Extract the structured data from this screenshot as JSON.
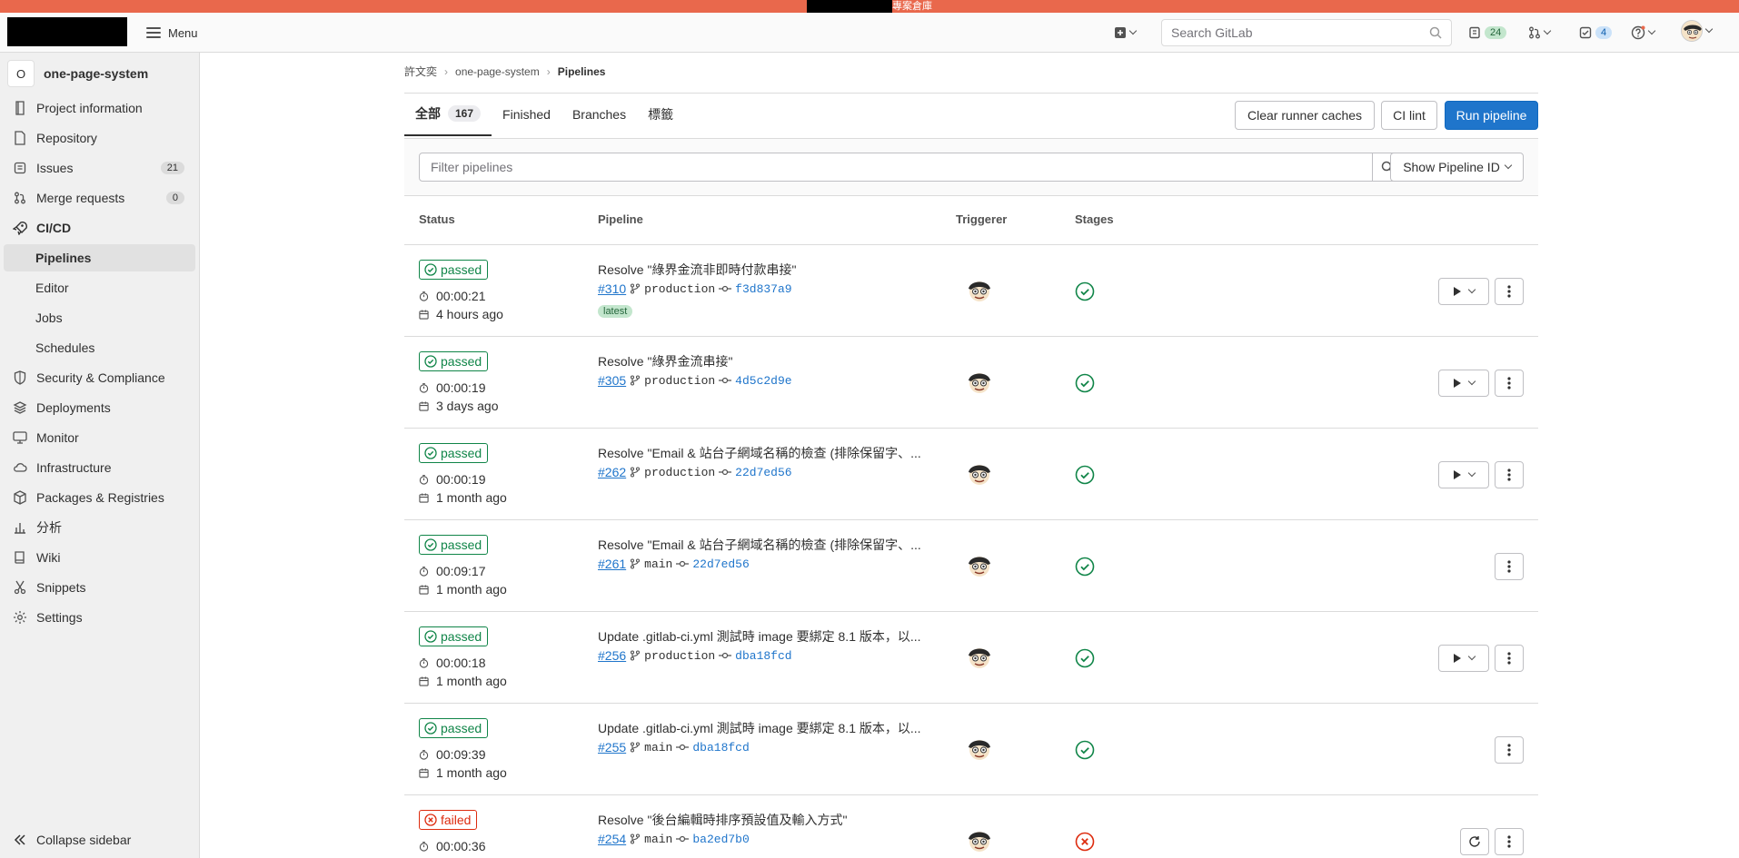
{
  "banner": {
    "text": "專案倉庫",
    "color": "#e9684c"
  },
  "topbar": {
    "menu_label": "Menu",
    "search_placeholder": "Search GitLab",
    "issues_count": "24",
    "todos_count": "4"
  },
  "sidebar": {
    "project_initial": "O",
    "project_name": "one-page-system",
    "items": [
      {
        "label": "Project information",
        "icon": "info-icon"
      },
      {
        "label": "Repository",
        "icon": "doc-icon"
      },
      {
        "label": "Issues",
        "icon": "issues-icon",
        "count": "21"
      },
      {
        "label": "Merge requests",
        "icon": "merge-icon",
        "count": "0"
      },
      {
        "label": "CI/CD",
        "icon": "rocket-icon"
      },
      {
        "label": "Pipelines"
      },
      {
        "label": "Editor"
      },
      {
        "label": "Jobs"
      },
      {
        "label": "Schedules"
      },
      {
        "label": "Security & Compliance",
        "icon": "shield-icon"
      },
      {
        "label": "Deployments",
        "icon": "deploy-icon"
      },
      {
        "label": "Monitor",
        "icon": "monitor-icon"
      },
      {
        "label": "Infrastructure",
        "icon": "cloud-icon"
      },
      {
        "label": "Packages & Registries",
        "icon": "package-icon"
      },
      {
        "label": "分析",
        "icon": "chart-icon"
      },
      {
        "label": "Wiki",
        "icon": "book-icon"
      },
      {
        "label": "Snippets",
        "icon": "scissors-icon"
      },
      {
        "label": "Settings",
        "icon": "gear-icon"
      }
    ],
    "collapse_label": "Collapse sidebar"
  },
  "breadcrumb": {
    "owner": "許文奕",
    "project": "one-page-system",
    "current": "Pipelines"
  },
  "tabs": {
    "all_label": "全部",
    "all_count": "167",
    "finished": "Finished",
    "branches": "Branches",
    "tags": "標籤"
  },
  "buttons": {
    "clear_cache": "Clear runner caches",
    "ci_lint": "CI lint",
    "run_pipeline": "Run pipeline",
    "show_pid": "Show Pipeline ID"
  },
  "filter": {
    "placeholder": "Filter pipelines"
  },
  "table": {
    "headers": {
      "status": "Status",
      "pipeline": "Pipeline",
      "triggerer": "Triggerer",
      "stages": "Stages"
    },
    "rows": [
      {
        "status": "passed",
        "duration": "00:00:21",
        "ago": "4 hours ago",
        "title": "Resolve \"綠界金流非即時付款串接\"",
        "id": "#310",
        "ref": "production",
        "sha": "f3d837a9",
        "latest": "latest"
      },
      {
        "status": "passed",
        "duration": "00:00:19",
        "ago": "3 days ago",
        "title": "Resolve \"綠界金流串接\"",
        "id": "#305",
        "ref": "production",
        "sha": "4d5c2d9e"
      },
      {
        "status": "passed",
        "duration": "00:00:19",
        "ago": "1 month ago",
        "title": "Resolve \"Email & 站台子網域名稱的檢查 (排除保留字、...",
        "id": "#262",
        "ref": "production",
        "sha": "22d7ed56"
      },
      {
        "status": "passed",
        "duration": "00:09:17",
        "ago": "1 month ago",
        "title": "Resolve \"Email & 站台子網域名稱的檢查 (排除保留字、...",
        "id": "#261",
        "ref": "main",
        "sha": "22d7ed56"
      },
      {
        "status": "passed",
        "duration": "00:00:18",
        "ago": "1 month ago",
        "title": "Update .gitlab-ci.yml 測試時 image 要綁定 8.1 版本，以...",
        "id": "#256",
        "ref": "production",
        "sha": "dba18fcd"
      },
      {
        "status": "passed",
        "duration": "00:09:39",
        "ago": "1 month ago",
        "title": "Update .gitlab-ci.yml 測試時 image 要綁定 8.1 版本，以...",
        "id": "#255",
        "ref": "main",
        "sha": "dba18fcd"
      },
      {
        "status": "failed",
        "duration": "00:00:36",
        "ago": "",
        "title": "Resolve \"後台編輯時排序預設值及輸入方式\"",
        "id": "#254",
        "ref": "main",
        "sha": "ba2ed7b0"
      }
    ]
  },
  "colors": {
    "success": "#108548",
    "danger": "#dd2b0e",
    "link": "#1f75cb",
    "primary": "#1f75cb"
  }
}
